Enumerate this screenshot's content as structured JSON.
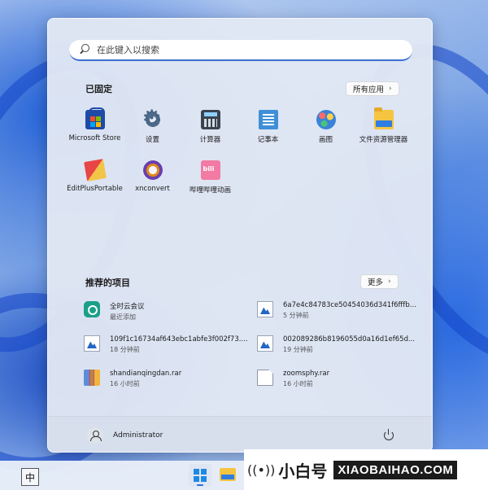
{
  "search": {
    "placeholder": "在此键入以搜索"
  },
  "pinned": {
    "title": "已固定",
    "all_apps_label": "所有应用",
    "apps": [
      {
        "label": "Microsoft Store",
        "icon": "microsoft-store-icon"
      },
      {
        "label": "设置",
        "icon": "settings-gear-icon"
      },
      {
        "label": "计算器",
        "icon": "calculator-icon"
      },
      {
        "label": "记事本",
        "icon": "notepad-icon"
      },
      {
        "label": "画图",
        "icon": "paint-icon"
      },
      {
        "label": "文件资源管理器",
        "icon": "file-explorer-icon"
      },
      {
        "label": "EditPlusPortable",
        "icon": "editplus-icon"
      },
      {
        "label": "xnconvert",
        "icon": "xnconvert-icon"
      },
      {
        "label": "哔哩哔哩动画",
        "icon": "bilibili-icon"
      }
    ]
  },
  "recommended": {
    "title": "推荐的项目",
    "more_label": "更多",
    "items": [
      {
        "name": "全时云会议",
        "time": "最近添加",
        "icon": "meeting-app-icon"
      },
      {
        "name": "6a7e4c84783ce50454036d341f6fffb...",
        "time": "5 分钟前",
        "icon": "image-file-icon"
      },
      {
        "name": "109f1c16734af643ebc1abfe3f002f73....",
        "time": "18 分钟前",
        "icon": "image-file-icon"
      },
      {
        "name": "002089286b8196055d0a16d1ef65d...",
        "time": "19 分钟前",
        "icon": "image-file-icon"
      },
      {
        "name": "shandianqingdan.rar",
        "time": "16 小时前",
        "icon": "rar-archive-icon"
      },
      {
        "name": "zoomsphy.rar",
        "time": "16 小时前",
        "icon": "blank-file-icon"
      }
    ]
  },
  "footer": {
    "user_name": "Administrator"
  },
  "taskbar": {
    "ime_label": "中"
  },
  "brand": {
    "cn": "小白号",
    "en": "XIAOBAIHAO.COM"
  },
  "colors": {
    "accent": "#3c6fd1",
    "panel": "#e2e8f4"
  }
}
